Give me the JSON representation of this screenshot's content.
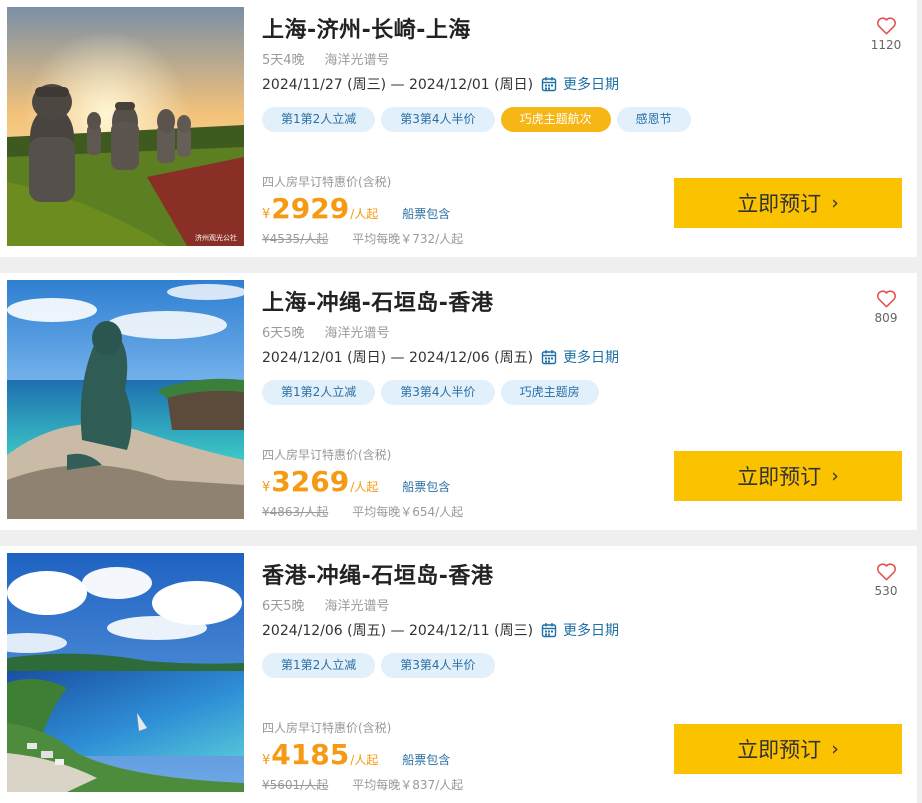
{
  "cruises": [
    {
      "title": "上海-济州-长崎-上海",
      "duration": "5天4晚",
      "ship": "海洋光谱号",
      "date_range": "2024/11/27 (周三) — 2024/12/01 (周日)",
      "more_dates": "更多日期",
      "tags": [
        "第1第2人立减",
        "第3第4人半价",
        "巧虎主题航次",
        "感恩节"
      ],
      "highlight_tag_index": 2,
      "price_label": "四人房早订特惠价(含税)",
      "currency": "¥",
      "price": "2929",
      "per_person": "/人起",
      "included": "船票包含",
      "original_price": "¥4535/人起",
      "nightly": "平均每晚￥732/人起",
      "book_label": "立即预订",
      "favorites": "1120",
      "image_caption": "济州观光公社",
      "image_icon": "jeju-stone-statues-image"
    },
    {
      "title": "上海-冲绳-石垣岛-香港",
      "duration": "6天5晚",
      "ship": "海洋光谱号",
      "date_range": "2024/12/01 (周日) — 2024/12/06 (周五)",
      "more_dates": "更多日期",
      "tags": [
        "第1第2人立减",
        "第3第4人半价",
        "巧虎主题房"
      ],
      "highlight_tag_index": -1,
      "price_label": "四人房早订特惠价(含税)",
      "currency": "¥",
      "price": "3269",
      "per_person": "/人起",
      "included": "船票包含",
      "original_price": "¥4863/人起",
      "nightly": "平均每晚￥654/人起",
      "book_label": "立即预订",
      "favorites": "809",
      "image_icon": "mermaid-statue-image"
    },
    {
      "title": "香港-冲绳-石垣岛-香港",
      "duration": "6天5晚",
      "ship": "海洋光谱号",
      "date_range": "2024/12/06 (周五) — 2024/12/11 (周三)",
      "more_dates": "更多日期",
      "tags": [
        "第1第2人立减",
        "第3第4人半价"
      ],
      "highlight_tag_index": -1,
      "price_label": "四人房早订特惠价(含税)",
      "currency": "¥",
      "price": "4185",
      "per_person": "/人起",
      "included": "船票包含",
      "original_price": "¥5601/人起",
      "nightly": "平均每晚￥837/人起",
      "book_label": "立即预订",
      "favorites": "530",
      "image_icon": "okinawa-coast-image"
    }
  ],
  "colors": {
    "accent_price": "#f59a12",
    "button_bg": "#fbc200",
    "tag_bg": "#e1f0fb",
    "tag_text": "#2a6ea3",
    "tag_highlight": "#f6b615",
    "heart": "#e0534f"
  }
}
